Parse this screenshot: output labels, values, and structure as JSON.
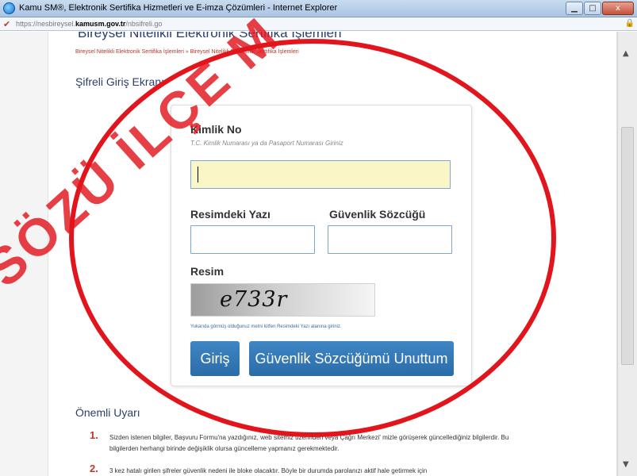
{
  "window": {
    "title": "Kamu SM®, Elektronik Sertifika Hizmetleri ve E-imza Çözümleri - Internet Explorer",
    "controls": {
      "minimize": "▁",
      "maximize": "□",
      "close": "x"
    }
  },
  "address": {
    "prefix": "https://nesbireysel.",
    "domain": "kamusm.gov.tr",
    "path": "/nbsifreli.go"
  },
  "page": {
    "heading": "Bireysel Nitelikli Elektronik Sertifika İşlemleri",
    "breadcrumb": "Bireysel Nitelikli Elektronik Sertifika İşlemleri » Bireysel Nitelikli Elektronik Sertifika İşlemleri",
    "section_title": "Şifreli Giriş Ekranı"
  },
  "form": {
    "kimlik_label": "Kimlik No",
    "kimlik_hint": "T.C. Kimlik Numarası ya da Pasaport Numarası Giriniz",
    "kimlik_value": "",
    "resim_yazi_label": "Resimdeki Yazı",
    "resim_yazi_value": "",
    "guvenlik_label": "Güvenlik Sözcüğü",
    "guvenlik_value": "",
    "resim_label": "Resim",
    "captcha_text": "e733r",
    "captcha_note": "Yukarıda görmüş olduğunuz metni lütfen Resimdeki Yazı alanına giriniz.",
    "login_button": "Giriş",
    "forgot_button": "Güvenlik Sözcüğümü Unuttum"
  },
  "warnings": {
    "title": "Önemli Uyarı",
    "items": [
      {
        "num": "1.",
        "text": "Sizden istenen bilgiler, Başvuru Formu'na yazdığınız, web sitemiz üzerinden veya Çağrı Merkezi' mizle görüşerek güncellediğiniz bilgilerdir. Bu bilgilerden herhangi birinde değişiklik olursa güncelleme yapmanız gerekmektedir."
      },
      {
        "num": "2.",
        "text": "3 kez hatalı girilen şifreler güvenlik nedeni ile bloke olacaktır. Böyle bir durumda parolanızı aktif hale getirmek için"
      }
    ]
  },
  "overlay": {
    "stamp_text": "SÖZÜ İLÇE M",
    "stamp_color": "#e2151d"
  },
  "colors": {
    "accent": "#2a6ca8",
    "circle": "#e2151d",
    "input_active": "#fbf6c6"
  }
}
